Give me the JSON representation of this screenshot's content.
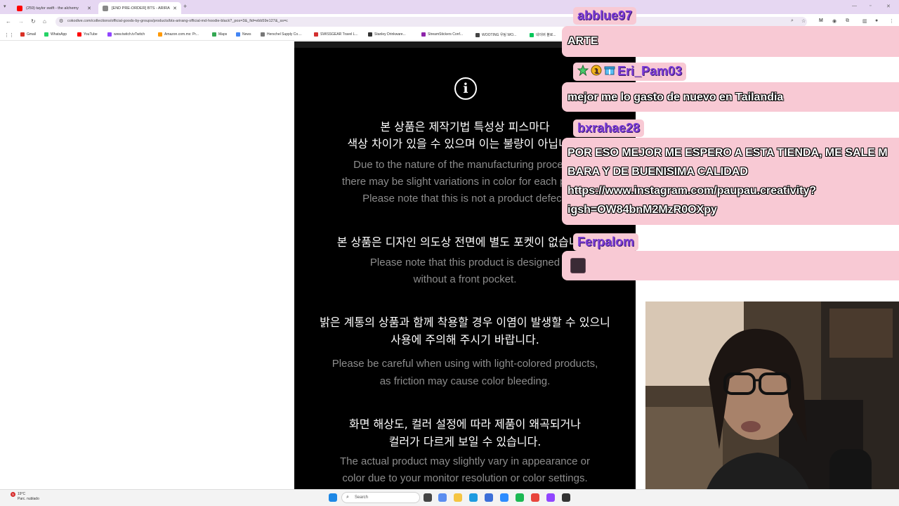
{
  "browser": {
    "tabs": [
      {
        "title": "(259) taylor swift - the alchemy",
        "favicon_color": "#ff0000"
      },
      {
        "title": "[END PRE-ORDER] BTS - ARIRANG",
        "favicon_color": "#888888"
      }
    ],
    "new_tab_label": "+",
    "close_label": "✕",
    "url": "cokodive.com/collections/official-goods-by-groups/products/bts-arirang-official-md-hoodie-black?_pos=3&_fid=ebb59e127&_ss=c",
    "bookmarks": [
      {
        "label": "Gmail",
        "color": "#d93025"
      },
      {
        "label": "WhatsApp",
        "color": "#25d366"
      },
      {
        "label": "YouTube",
        "color": "#ff0000"
      },
      {
        "label": "www.twitch.tvTwitch",
        "color": "#9146ff"
      },
      {
        "label": "Amazon.com.mx: Pr...",
        "color": "#ff9900"
      },
      {
        "label": "Maps",
        "color": "#34a853"
      },
      {
        "label": "News",
        "color": "#4285f4"
      },
      {
        "label": "Herschel Supply Co....",
        "color": "#777777"
      },
      {
        "label": "SWISSGEAR Travel L...",
        "color": "#d32f2f"
      },
      {
        "label": "Stanley Drinkware...",
        "color": "#333333"
      },
      {
        "label": "StreamStickers Conf...",
        "color": "#8e24aa"
      },
      {
        "label": "WOOTING 우팅 WO...",
        "color": "#444444"
      },
      {
        "label": "네이버 블로...",
        "color": "#03c75a"
      }
    ]
  },
  "product_notice": {
    "icon": "info-icon",
    "ko_1a": "본 상품은 제작기법 특성상 피스마다",
    "ko_1b": "색상 차이가 있을 수 있으며 이는 불량이 아닙니다.",
    "en_1a": "Due to the nature of the manufacturing process,",
    "en_1b": "there may be slight variations in color for each piece.",
    "en_1c": "Please note that this is not a product defect.",
    "ko_2": "본 상품은 디자인 의도상 전면에 별도 포켓이 없습니다.",
    "en_2a": "Please note that this product is designed",
    "en_2b": "without a front pocket.",
    "ko_3a": "밝은 계통의 상품과 함께 착용할 경우 이염이 발생할 수 있으니",
    "ko_3b": "사용에 주의해 주시기 바랍니다.",
    "en_3a": "Please be careful when using with light-colored products,",
    "en_3b": "as friction may cause color bleeding.",
    "ko_4a": "화면 해상도, 컬러 설정에 따라 제품이 왜곡되거나",
    "ko_4b": "컬러가 다르게 보일 수 있습니다.",
    "en_4a": "The actual product may slightly vary in appearance or",
    "en_4b": "color due to your monitor resolution or color settings."
  },
  "chat": {
    "messages": [
      {
        "user": "abblue97",
        "lines": [
          "ARTE"
        ]
      },
      {
        "user": "Eri_Pam03",
        "lines": [
          "mejor me lo gasto de nuevo en Tailandia"
        ]
      },
      {
        "user": "bxrahae28",
        "lines": [
          "POR ESO MEJOR ME ESPERO A ESTA TIENDA, ME SALE M",
          "BARA Y DE BUENISIMA CALIDAD",
          "https://www.instagram.com/paupau.creativity?",
          "igsh=OW84bnM2MzR0OXpy"
        ]
      },
      {
        "user": "Ferpalom",
        "lines": []
      }
    ],
    "bubble_color": "#f8c9d4",
    "username_color": "#7a3bd6"
  },
  "taskbar": {
    "weather_temp": "19°C",
    "weather_desc": "Parc. nublado",
    "weather_badge": "5",
    "search_placeholder": "Search"
  }
}
